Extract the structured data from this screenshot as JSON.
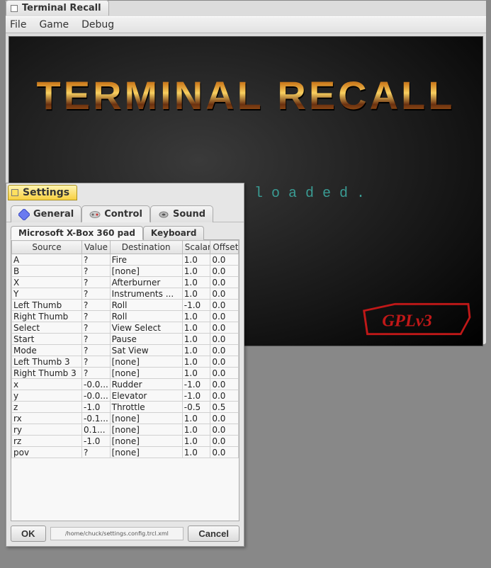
{
  "mainWindow": {
    "title": "Terminal Recall",
    "menu": {
      "file": "File",
      "game": "Game",
      "debug": "Debug"
    },
    "logoText": "TERMINAL RECALL",
    "statusText": "No game loaded.",
    "badge": "GPLv3"
  },
  "settings": {
    "title": "Settings",
    "categories": {
      "general": "General",
      "control": "Control",
      "sound": "Sound"
    },
    "controllerTabs": {
      "xbox": "Microsoft X-Box 360 pad",
      "keyboard": "Keyboard"
    },
    "columns": {
      "source": "Source",
      "value": "Value",
      "destination": "Destination",
      "scalar": "Scalar",
      "offset": "Offset"
    },
    "rows": [
      {
        "source": "A",
        "value": "?",
        "destination": "Fire",
        "scalar": "1.0",
        "offset": "0.0"
      },
      {
        "source": "B",
        "value": "?",
        "destination": "[none]",
        "scalar": "1.0",
        "offset": "0.0"
      },
      {
        "source": "X",
        "value": "?",
        "destination": "Afterburner",
        "scalar": "1.0",
        "offset": "0.0"
      },
      {
        "source": "Y",
        "value": "?",
        "destination": "Instruments ...",
        "scalar": "1.0",
        "offset": "0.0"
      },
      {
        "source": "Left Thumb",
        "value": "?",
        "destination": "Roll",
        "scalar": "-1.0",
        "offset": "0.0"
      },
      {
        "source": "Right Thumb",
        "value": "?",
        "destination": "Roll",
        "scalar": "1.0",
        "offset": "0.0"
      },
      {
        "source": "Select",
        "value": "?",
        "destination": "View Select",
        "scalar": "1.0",
        "offset": "0.0"
      },
      {
        "source": "Start",
        "value": "?",
        "destination": "Pause",
        "scalar": "1.0",
        "offset": "0.0"
      },
      {
        "source": "Mode",
        "value": "?",
        "destination": "Sat View",
        "scalar": "1.0",
        "offset": "0.0"
      },
      {
        "source": "Left Thumb 3",
        "value": "?",
        "destination": "[none]",
        "scalar": "1.0",
        "offset": "0.0"
      },
      {
        "source": "Right Thumb 3",
        "value": "?",
        "destination": "[none]",
        "scalar": "1.0",
        "offset": "0.0"
      },
      {
        "source": "x",
        "value": "-0.0...",
        "destination": "Rudder",
        "scalar": "-1.0",
        "offset": "0.0"
      },
      {
        "source": "y",
        "value": "-0.0...",
        "destination": "Elevator",
        "scalar": "-1.0",
        "offset": "0.0"
      },
      {
        "source": "z",
        "value": "-1.0",
        "destination": "Throttle",
        "scalar": "-0.5",
        "offset": "0.5"
      },
      {
        "source": "rx",
        "value": "-0.1...",
        "destination": "[none]",
        "scalar": "1.0",
        "offset": "0.0"
      },
      {
        "source": "ry",
        "value": "0.1...",
        "destination": "[none]",
        "scalar": "1.0",
        "offset": "0.0"
      },
      {
        "source": "rz",
        "value": "-1.0",
        "destination": "[none]",
        "scalar": "1.0",
        "offset": "0.0"
      },
      {
        "source": "pov",
        "value": "?",
        "destination": "[none]",
        "scalar": "1.0",
        "offset": "0.0"
      }
    ],
    "configPath": "/home/chuck/settings.config.trcl.xml",
    "buttons": {
      "ok": "OK",
      "cancel": "Cancel"
    }
  }
}
